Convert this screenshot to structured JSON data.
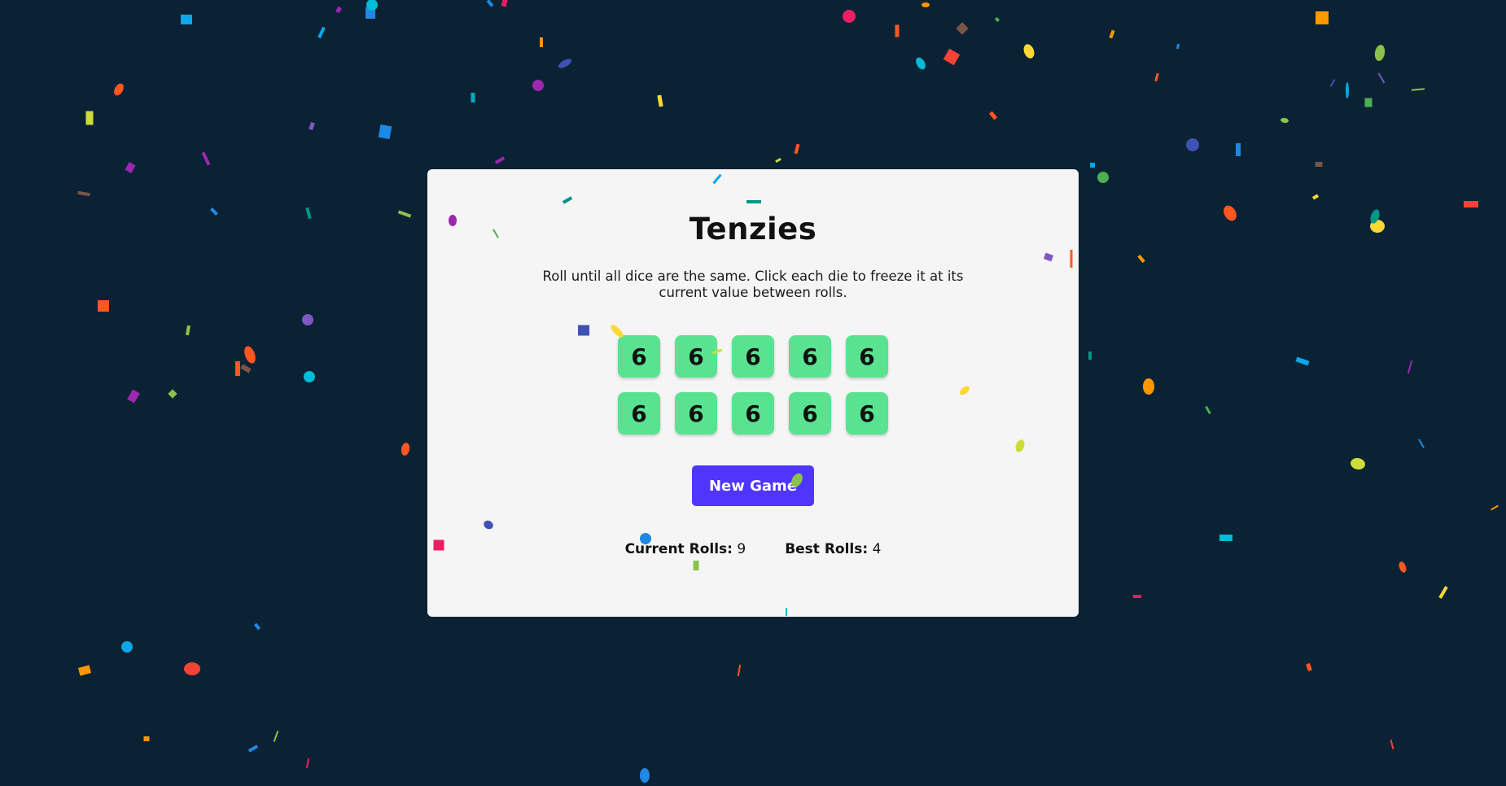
{
  "app": {
    "title": "Tenzies",
    "instructions": "Roll until all dice are the same. Click each die to freeze it at its current value between rolls."
  },
  "dice": [
    {
      "value": "6",
      "held": true
    },
    {
      "value": "6",
      "held": true
    },
    {
      "value": "6",
      "held": true
    },
    {
      "value": "6",
      "held": true
    },
    {
      "value": "6",
      "held": true
    },
    {
      "value": "6",
      "held": true
    },
    {
      "value": "6",
      "held": true
    },
    {
      "value": "6",
      "held": true
    },
    {
      "value": "6",
      "held": true
    },
    {
      "value": "6",
      "held": true
    }
  ],
  "controls": {
    "new_game_label": "New Game"
  },
  "stats": {
    "current_rolls_label": "Current Rolls:",
    "current_rolls_value": "9",
    "best_rolls_label": "Best Rolls:",
    "best_rolls_value": "4"
  },
  "colors": {
    "background": "#0b2234",
    "card": "#f5f5f5",
    "die_held": "#59e391",
    "button": "#5035ff"
  }
}
